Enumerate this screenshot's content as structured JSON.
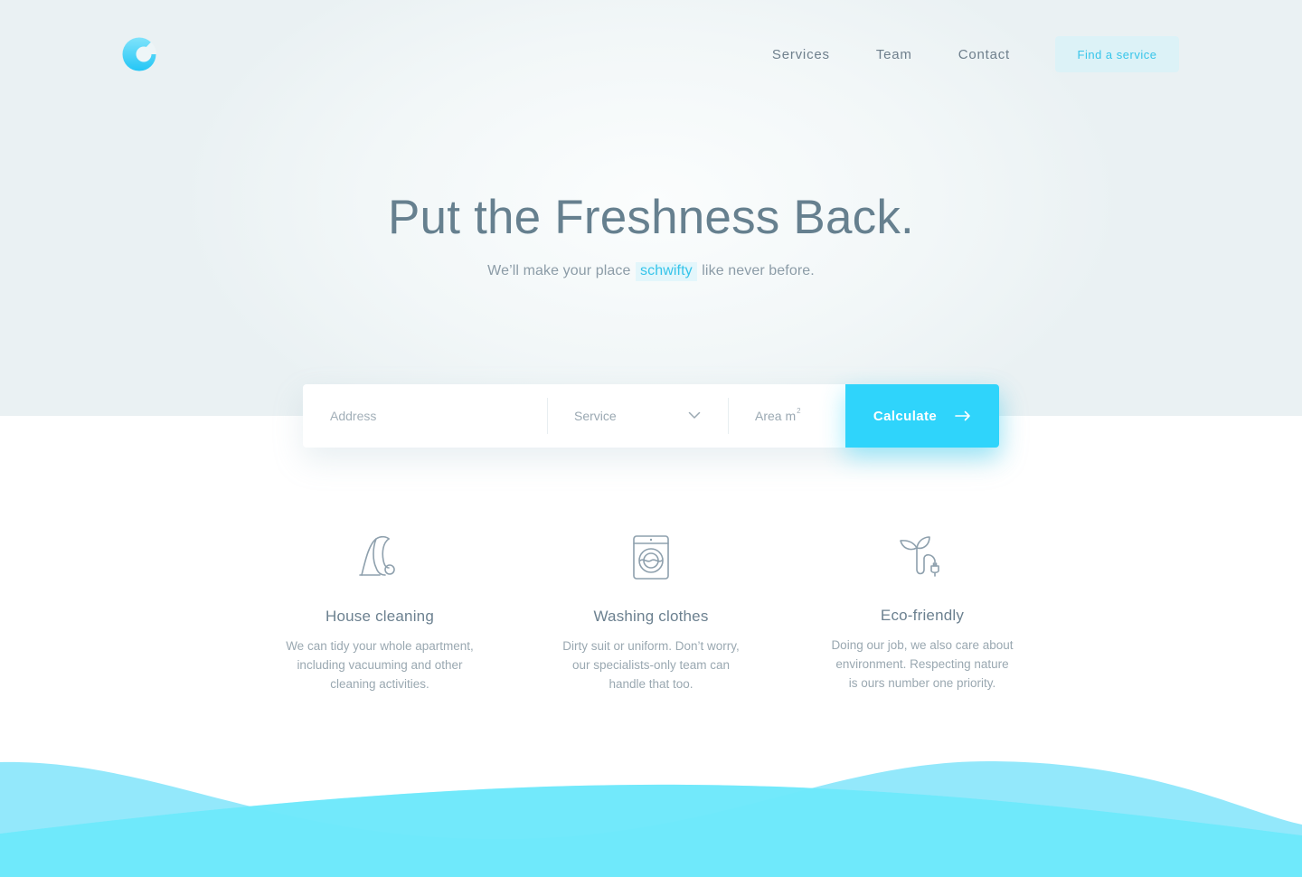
{
  "nav": {
    "links": [
      "Services",
      "Team",
      "Contact"
    ],
    "cta": "Find a service"
  },
  "hero": {
    "headline": "Put the Freshness Back.",
    "sub_before": "We’ll make your place",
    "sub_highlight": "schwifty",
    "sub_after": "like never before."
  },
  "search": {
    "address_placeholder": "Address",
    "service_placeholder": "Service",
    "area_placeholder": "Area m",
    "area_sup": "2",
    "calculate": "Calculate"
  },
  "features": [
    {
      "icon": "vacuum-cleaner-icon",
      "title": "House cleaning",
      "lines": [
        "We can tidy your whole apartment,",
        "including vacuuming and other",
        "cleaning activities."
      ]
    },
    {
      "icon": "washing-machine-icon",
      "title": "Washing clothes",
      "lines": [
        "Dirty suit or uniform. Don’t worry,",
        "our specialists-only team can",
        "handle that too."
      ]
    },
    {
      "icon": "eco-plant-plug-icon",
      "title": "Eco-friendly",
      "lines": [
        "Doing our job, we also care about",
        "environment. Respecting nature",
        "is ours number one priority."
      ]
    }
  ],
  "colors": {
    "accent": "#2fd4fb",
    "cta_bg": "#dcf2f7",
    "text": "#6b7d8c"
  }
}
